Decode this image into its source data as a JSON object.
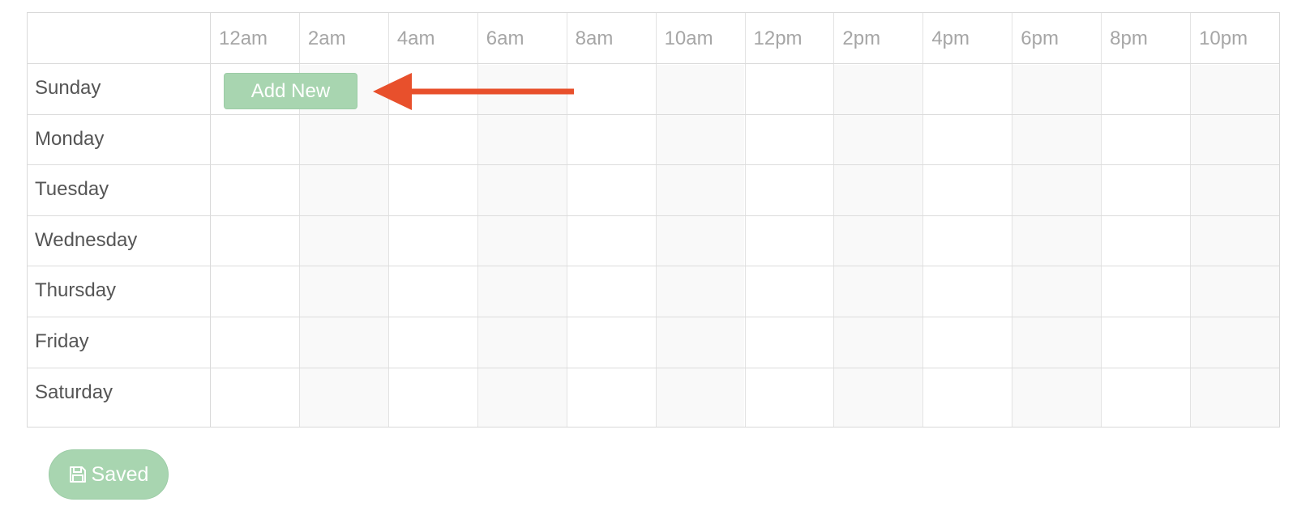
{
  "schedule": {
    "hours": [
      "12am",
      "2am",
      "4am",
      "6am",
      "8am",
      "10am",
      "12pm",
      "2pm",
      "4pm",
      "6pm",
      "8pm",
      "10pm"
    ],
    "days": [
      "Sunday",
      "Monday",
      "Tuesday",
      "Wednesday",
      "Thursday",
      "Friday",
      "Saturday"
    ]
  },
  "add_new_label": "Add New",
  "saved_button": {
    "label": "Saved",
    "icon": "save-icon"
  },
  "colors": {
    "button_green": "#a8d5b0",
    "annotation_arrow": "#e8502c",
    "stripe": "#f9f9f9",
    "grid_border": "#d9d9d9"
  }
}
